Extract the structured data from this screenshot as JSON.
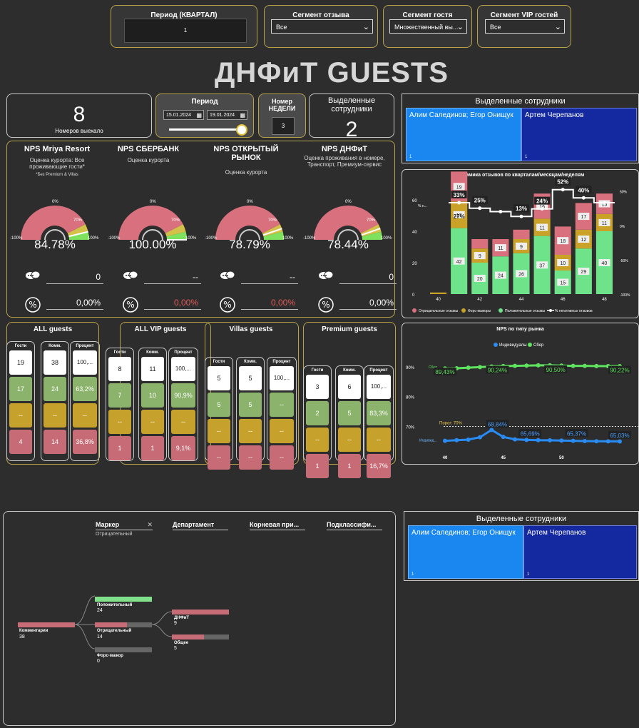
{
  "filters": {
    "period_quarter": {
      "label": "Период (КВАРТАЛ)",
      "value": "1"
    },
    "review_segment": {
      "label": "Сегмент отзыва",
      "value": "Все"
    },
    "guest_segment": {
      "label": "Сегмент гостя",
      "value": "Множественный вы..."
    },
    "vip_segment": {
      "label": "Сегмент VIP гостей",
      "value": "Все"
    }
  },
  "title": "ДНФиТ GUESTS",
  "kpi_rooms": {
    "value": "8",
    "label": "Номеров выехало"
  },
  "period": {
    "label": "Период",
    "start": "15.01.2024",
    "end": "19.01.2024"
  },
  "week": {
    "label": "Номер НЕДЕЛИ",
    "value": "3"
  },
  "selected_count": {
    "label": "Выделенные сотрудники",
    "value": "2"
  },
  "employees_top": {
    "title": "Выделенные сотрудники",
    "cells": [
      {
        "text": "Алим Салединов; Егор Онищук",
        "n": "1"
      },
      {
        "text": "Артем Черепанов",
        "n": "1"
      }
    ]
  },
  "employees_bottom": {
    "title": "Выделенные сотрудники",
    "cells": [
      {
        "text": "Алим Салединов; Егор Онищук",
        "n": "1"
      },
      {
        "text": "Артем Черепанов",
        "n": "1"
      }
    ]
  },
  "gauge_labels": {
    "zero": "0%",
    "seventy": "70%",
    "min": "-100%",
    "max": "100%"
  },
  "nps": [
    {
      "title": "NPS Mriya Resort",
      "sub": "Оценка курорта: Все проживающие гости*",
      "note": "*Без Premium & Villas",
      "value": "84.78%",
      "level": 0.8478,
      "comments": "0",
      "percent": "0,00%",
      "percent_color": "#ffffff"
    },
    {
      "title": "NPS СБЕРБАНК",
      "sub": "Оценка курорта",
      "note": "",
      "value": "100.00%",
      "level": 1.0,
      "comments": "--",
      "percent": "0,00%",
      "percent_color": "#e05a5a"
    },
    {
      "title": "NPS ОТКРЫТЫЙ РЫНОК",
      "sub": "Оценка курорта",
      "note": "",
      "value": "78.79%",
      "level": 0.7879,
      "comments": "--",
      "percent": "0,00%",
      "percent_color": "#e05a5a"
    },
    {
      "title": "NPS ДНФиТ",
      "sub": "Оценка проживания в номере, Транспорт, Премиум-сервис",
      "note": "",
      "value": "78.44%",
      "level": 0.7844,
      "comments": "0",
      "percent": "0,00%",
      "percent_color": "#ffffff"
    }
  ],
  "guest_headers": {
    "guests": "Гости",
    "comments": "Комм.",
    "percent": "Процент"
  },
  "guest_groups": [
    {
      "title": "ALL guests",
      "guests": [
        "19",
        "17",
        "--",
        "4"
      ],
      "comments": [
        "38",
        "24",
        "--",
        "14"
      ],
      "percent": [
        "100,...",
        "63,2%",
        "--",
        "36,8%"
      ]
    },
    {
      "title": "ALL VIP guests",
      "guests": [
        "8",
        "7",
        "--",
        "1"
      ],
      "comments": [
        "11",
        "10",
        "--",
        "1"
      ],
      "percent": [
        "100,...",
        "90,9%",
        "--",
        "9,1%"
      ]
    },
    {
      "title": "Villas guests",
      "guests": [
        "5",
        "5",
        "--",
        "--"
      ],
      "comments": [
        "5",
        "5",
        "--",
        "--"
      ],
      "percent": [
        "100,...",
        "--",
        "--",
        "--"
      ]
    },
    {
      "title": "Premium guests",
      "guests": [
        "3",
        "2",
        "--",
        "1"
      ],
      "comments": [
        "6",
        "5",
        "--",
        "1"
      ],
      "percent": [
        "100,...",
        "83,3%",
        "--",
        "16,7%"
      ]
    }
  ],
  "dynamics_chart": {
    "title": "Динамика отзывов по кварталам/месяцам/неделям",
    "ylabel": "% н...",
    "chart_data": {
      "type": "bar",
      "categories": [
        "40",
        "41",
        "42",
        "43",
        "44",
        "45",
        "46",
        "47",
        "48"
      ],
      "x_tick_labels": [
        "40",
        "42",
        "44",
        "46",
        "48"
      ],
      "y_ticks_left": [
        "0",
        "20",
        "40",
        "60"
      ],
      "y_ticks_right": [
        "-100%",
        "-50%",
        "0%",
        "50%"
      ],
      "series": [
        {
          "name": "Отрицательные отзывы",
          "values": [
            0,
            19,
            6,
            11,
            6,
            16,
            18,
            17,
            13
          ],
          "labels": [
            "",
            "19",
            "",
            "11",
            "",
            "16",
            "18",
            "17",
            "13"
          ],
          "color": "#d9707d"
        },
        {
          "name": "Форс-мажоры",
          "values": [
            1,
            17,
            9,
            0,
            9,
            11,
            10,
            12,
            11
          ],
          "labels": [
            "",
            "17",
            "9",
            "",
            "9",
            "11",
            "10",
            "12",
            "11"
          ],
          "color": "#c9a227"
        },
        {
          "name": "Положительные отзывы",
          "values": [
            0,
            42,
            20,
            24,
            26,
            37,
            15,
            29,
            40
          ],
          "labels": [
            "",
            "42",
            "20",
            "24",
            "26",
            "37",
            "15",
            "29",
            "40"
          ],
          "color": "#6ee38a"
        },
        {
          "name": "% негативных отзывов",
          "values": [
            null,
            33,
            25,
            20,
            13,
            24,
            52,
            40,
            33
          ],
          "labels": [
            "",
            "33%",
            "25%",
            "",
            "13%",
            "24%",
            "52%",
            "40%",
            ""
          ],
          "color": "#ffffff"
        }
      ],
      "extra_label": "27%",
      "ylim": [
        0,
        70
      ]
    }
  },
  "nps_market_chart": {
    "title": "NPS по типу рынка",
    "legend": [
      "Индивидуалы",
      "Сбер"
    ],
    "threshold": "Порог: 70%",
    "y_ticks": [
      "70%",
      "80%",
      "90%"
    ],
    "x_ticks": [
      "40",
      "45",
      "50"
    ],
    "series_labels": {
      "sber": "Сбер",
      "indiv": "Индивид..."
    },
    "chart_data": {
      "type": "line",
      "x": [
        40,
        41,
        42,
        43,
        44,
        45,
        46,
        47,
        48,
        49,
        50,
        51,
        52,
        53,
        54,
        55
      ],
      "series": [
        {
          "name": "Сбер",
          "values": [
            89.43,
            89.5,
            89.7,
            89.9,
            90.1,
            90.24,
            90.3,
            90.4,
            90.5,
            90.5,
            90.4,
            90.3,
            90.3,
            90.25,
            90.22,
            90.22
          ],
          "color": "#5fe35f"
        },
        {
          "name": "Индивидуалы",
          "values": [
            65.2,
            65.4,
            65.6,
            66.4,
            68.84,
            66.5,
            65.69,
            65.5,
            65.4,
            65.37,
            65.3,
            65.2,
            65.1,
            65.05,
            65.03,
            65.0
          ],
          "color": "#2a8bf2"
        }
      ],
      "data_labels": [
        "89,43%",
        "90,24%",
        "90,50%",
        "90,22%",
        "68,84%",
        "65,69%",
        "65,37%",
        "65,03%"
      ],
      "ylim": [
        62,
        95
      ]
    }
  },
  "tree": {
    "headers": [
      {
        "title": "Маркер",
        "sub": "Отрицательный"
      },
      {
        "title": "Департамент",
        "sub": ""
      },
      {
        "title": "Корневая при...",
        "sub": ""
      },
      {
        "title": "Подклассифи...",
        "sub": ""
      }
    ],
    "root": {
      "label": "Комментарии",
      "value": "38"
    },
    "level1": [
      {
        "label": "Положительный",
        "value": "24"
      },
      {
        "label": "Отрицательный",
        "value": "14"
      },
      {
        "label": "Форс-мажор",
        "value": "0"
      }
    ],
    "level2": [
      {
        "label": "ДНФиТ",
        "value": "9"
      },
      {
        "label": "Общее",
        "value": "5"
      }
    ]
  }
}
